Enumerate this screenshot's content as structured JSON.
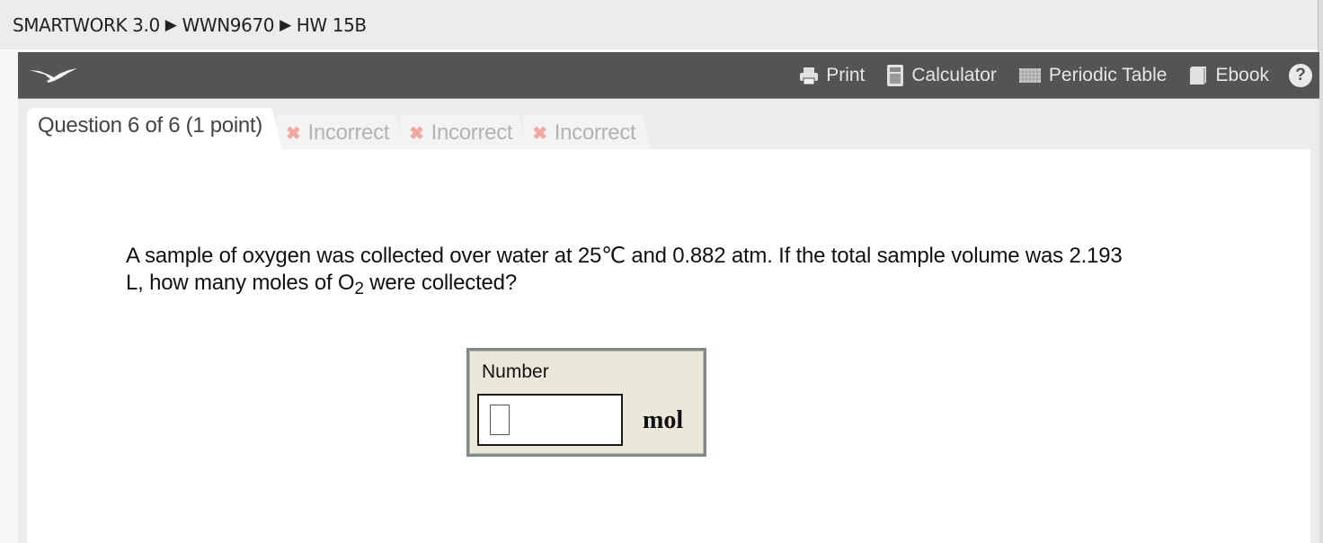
{
  "breadcrumb": {
    "items": [
      "SMARTWORK 3.0",
      "WWN9670",
      "HW 15B"
    ],
    "separator": "▶"
  },
  "toolbar": {
    "logo": "seagull-logo",
    "tools": [
      {
        "label": "Print",
        "icon": "printer-icon"
      },
      {
        "label": "Calculator",
        "icon": "calculator-icon"
      },
      {
        "label": "Periodic Table",
        "icon": "periodic-table-icon"
      },
      {
        "label": "Ebook",
        "icon": "book-icon"
      }
    ],
    "help_glyph": "?"
  },
  "tabs": {
    "active": "Question 6 of 6 (1 point)",
    "attempts": [
      {
        "label": "Incorrect",
        "status": "incorrect",
        "glyph": "✖"
      },
      {
        "label": "Incorrect",
        "status": "incorrect",
        "glyph": "✖"
      },
      {
        "label": "Incorrect",
        "status": "incorrect",
        "glyph": "✖"
      }
    ]
  },
  "question": {
    "line1": "A sample of oxygen was collected over water at 25℃ and 0.882 atm. If the total sample volume was 2.193",
    "line2_pre": "L, how many moles of O",
    "line2_sub": "2",
    "line2_post": " were collected?"
  },
  "answer": {
    "label": "Number",
    "value": "",
    "unit": "mol"
  },
  "colors": {
    "toolbar_bg": "#545454",
    "incorrect_x": "#f0a8a0",
    "answer_bg": "#ebe7d9"
  }
}
